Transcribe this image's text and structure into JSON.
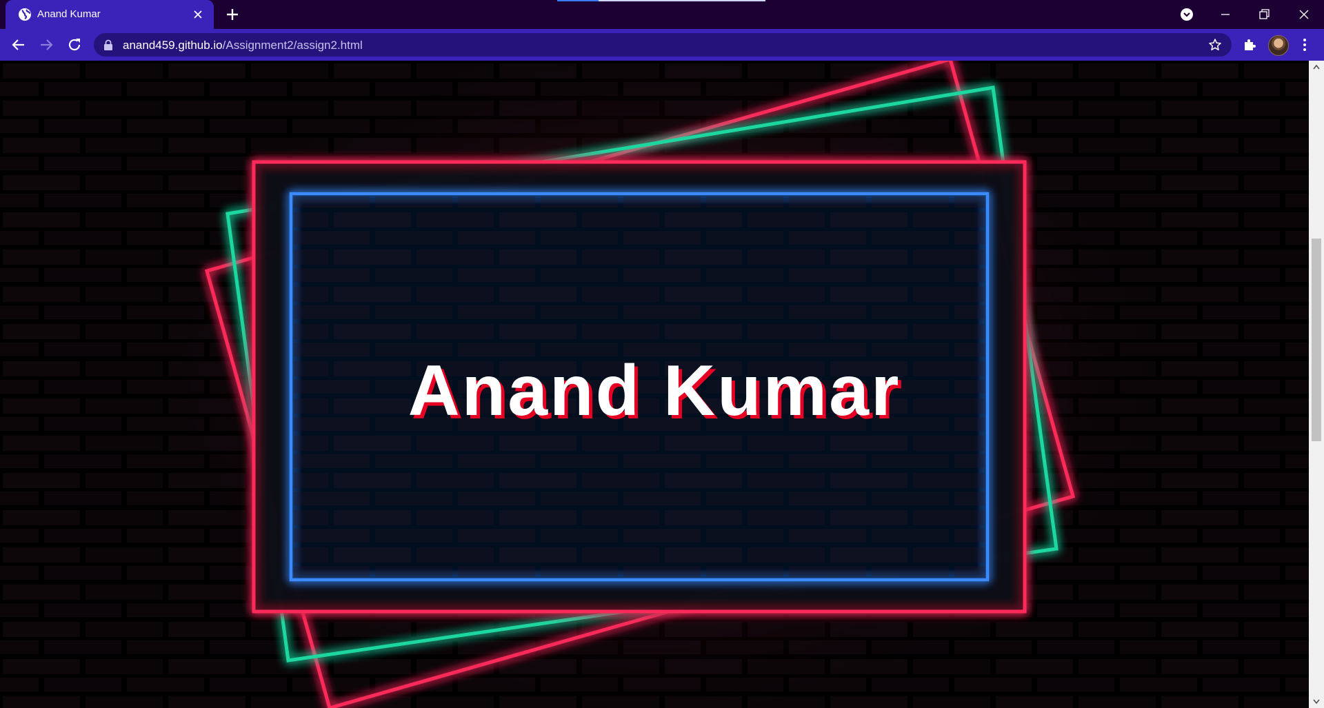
{
  "browser": {
    "tab_title": "Anand Kumar",
    "url_host": "anand459.github.io",
    "url_path": "/Assignment2/assign2.html",
    "theme_colors": {
      "frame": "#1d0033",
      "toolbar": "#3b22b9",
      "omnibox": "#25127a"
    }
  },
  "page": {
    "heading": "Anand Kumar",
    "colors": {
      "neon_red": "#ff2a5a",
      "neon_green": "#1fd8a0",
      "neon_blue": "#3a8bff",
      "text_shadow": "#e60023"
    },
    "icons": [
      "globe-icon",
      "close-icon",
      "plus-icon",
      "back-icon",
      "forward-icon",
      "reload-icon",
      "lock-icon",
      "star-icon",
      "puzzle-icon",
      "kebab-menu-icon"
    ]
  }
}
